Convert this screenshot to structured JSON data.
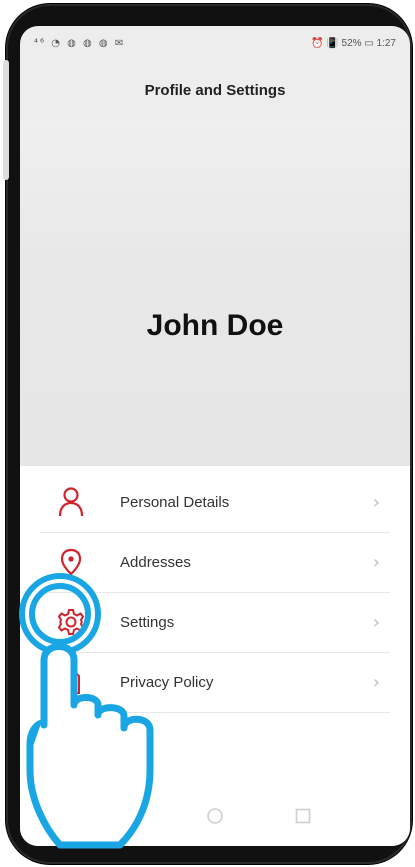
{
  "status": {
    "left_icons": "⁴⁶ ◔ ◍ ◍ ◍ ✉",
    "right_text": "⏰ 📳 52% ▭ 1:27"
  },
  "header": {
    "title": "Profile and Settings"
  },
  "profile": {
    "name": "John Doe"
  },
  "menu": {
    "items": [
      {
        "label": "Personal Details",
        "icon": "person-icon"
      },
      {
        "label": "Addresses",
        "icon": "location-pin-icon"
      },
      {
        "label": "Settings",
        "icon": "gear-icon"
      },
      {
        "label": "Privacy Policy",
        "icon": "document-icon"
      }
    ]
  },
  "colors": {
    "accent": "#d0242b",
    "highlight": "#1aa6e5"
  },
  "nav": {
    "buttons": [
      "back-icon",
      "home-icon",
      "recents-icon"
    ]
  }
}
